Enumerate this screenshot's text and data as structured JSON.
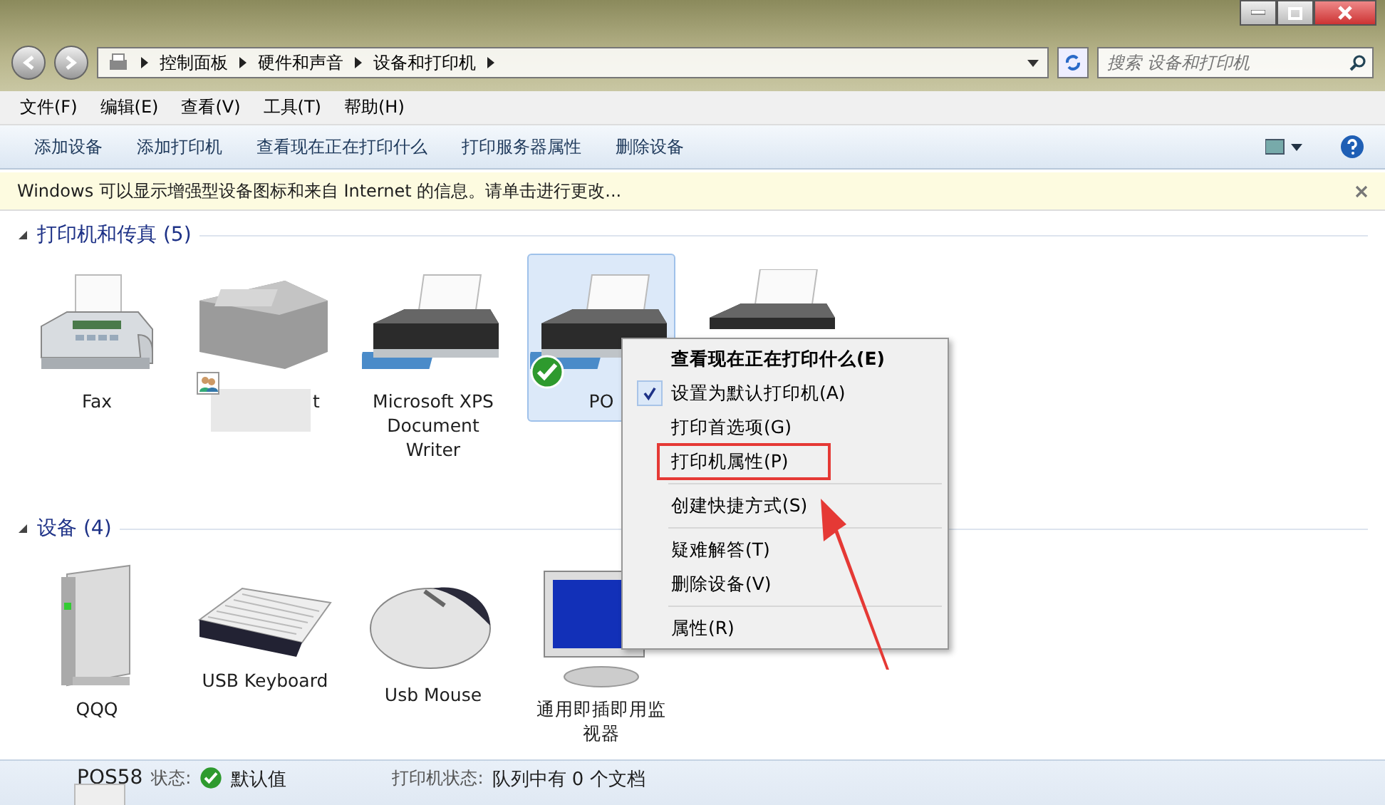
{
  "address": {
    "crumbs": [
      "控制面板",
      "硬件和声音",
      "设备和打印机"
    ]
  },
  "search": {
    "placeholder": "搜索 设备和打印机"
  },
  "menu_bar": [
    "文件(F)",
    "编辑(E)",
    "查看(V)",
    "工具(T)",
    "帮助(H)"
  ],
  "toolbar": [
    "添加设备",
    "添加打印机",
    "查看现在正在打印什么",
    "打印服务器属性",
    "删除设备"
  ],
  "info_bar": {
    "text": "Windows 可以显示增强型设备图标和来自 Internet 的信息。请单击进行更改..."
  },
  "sections": [
    {
      "title": "打印机和传真 (5)",
      "expanded": true,
      "items": [
        {
          "kind": "fax",
          "label": "Fax",
          "selected": false,
          "default": false,
          "shared": false
        },
        {
          "kind": "mfp",
          "label": "t",
          "selected": false,
          "default": false,
          "shared": true
        },
        {
          "kind": "printer",
          "label": "Microsoft XPS Document Writer",
          "selected": false,
          "default": false,
          "shared": false
        },
        {
          "kind": "printer",
          "label": "PO",
          "selected": true,
          "default": true,
          "shared": false
        },
        {
          "kind": "printer",
          "selected": false,
          "default": false,
          "shared": false
        }
      ]
    },
    {
      "title": "设备 (4)",
      "expanded": true,
      "items": [
        {
          "kind": "drive",
          "label": "QQQ",
          "selected": false,
          "default": false,
          "shared": false
        },
        {
          "kind": "keyboard",
          "label": "USB Keyboard",
          "selected": false,
          "default": false,
          "shared": false
        },
        {
          "kind": "mouse",
          "label": "Usb Mouse",
          "selected": false,
          "default": false,
          "shared": false
        },
        {
          "kind": "monitor",
          "label": "通用即插即用监视器",
          "selected": false,
          "default": false,
          "shared": false
        }
      ]
    }
  ],
  "context_menu": [
    {
      "label": "查看现在正在打印什么(E)",
      "bold": true,
      "checked": false,
      "separator_before": false,
      "annotated": false
    },
    {
      "label": "设置为默认打印机(A)",
      "bold": false,
      "checked": true,
      "separator_before": false,
      "annotated": false
    },
    {
      "label": "打印首选项(G)",
      "bold": false,
      "checked": false,
      "separator_before": false,
      "annotated": false
    },
    {
      "label": "打印机属性(P)",
      "bold": false,
      "checked": false,
      "separator_before": false,
      "annotated": true
    },
    {
      "label": "创建快捷方式(S)",
      "bold": false,
      "checked": false,
      "separator_before": true,
      "annotated": false
    },
    {
      "label": "疑难解答(T)",
      "bold": false,
      "checked": false,
      "separator_before": true,
      "annotated": false
    },
    {
      "label": "删除设备(V)",
      "bold": false,
      "checked": false,
      "separator_before": false,
      "annotated": false
    },
    {
      "label": "属性(R)",
      "bold": false,
      "checked": false,
      "separator_before": true,
      "annotated": false
    }
  ],
  "details": {
    "name": "POS58",
    "status_label": "状态:",
    "status": "默认值",
    "printer_status_label": "打印机状态:",
    "printer_status": "队列中有 0 个文档"
  }
}
